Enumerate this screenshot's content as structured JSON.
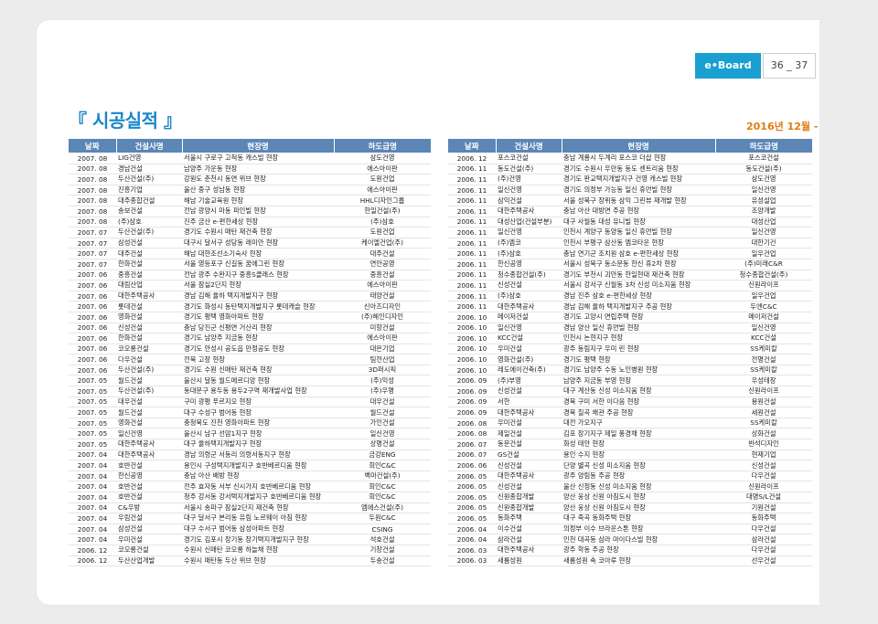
{
  "header": {
    "board_label": "e•Board",
    "page_numbers": "36 _ 37"
  },
  "section": {
    "title": "『 시공실적 』",
    "date": "2016년 12월 -"
  },
  "columns": [
    "날짜",
    "건설사명",
    "현장명",
    "하도급명"
  ],
  "left_rows": [
    [
      "2007. 08",
      "LIG건영",
      "서울시 구로구 고척동 캐스빌 현장",
      "삼도건영"
    ],
    [
      "2007. 08",
      "경남건설",
      "남양주 가운동 현장",
      "에스아이판"
    ],
    [
      "2007. 08",
      "두산건설(주)",
      "강원도 춘천시 동면 위브 현장",
      "도원건업"
    ],
    [
      "2007. 08",
      "진흥기업",
      "울산 중구 성남동 현장",
      "에스아이판"
    ],
    [
      "2007. 08",
      "대주종합건설",
      "해남 기술교육원 현장",
      "HHL디자인그룹"
    ],
    [
      "2007. 08",
      "송보건설",
      "전남 광양시 마동 파인빌 현장",
      "한일건설(주)"
    ],
    [
      "2007. 08",
      "(주)삼호",
      "진주 금산 e-편한세상 현장",
      "(주)삼호"
    ],
    [
      "2007. 07",
      "두산건설(주)",
      "경기도 수원시 매탄 재건축 현장",
      "도원건업"
    ],
    [
      "2007. 07",
      "삼성건설",
      "대구시 달서구 성당동 래미안 현장",
      "케이엘건업(주)"
    ],
    [
      "2007. 07",
      "대주건설",
      "해남 대한조선소기숙사 현장",
      "대주건설"
    ],
    [
      "2007. 07",
      "한화건설",
      "서울 영등포구 신길동 꿈에그린 현장",
      "연안공영"
    ],
    [
      "2007. 06",
      "중흥건설",
      "전남 광주 수완지구 중흥S클래스 현장",
      "중흥건설"
    ],
    [
      "2007. 06",
      "대림산업",
      "서울 잠실2단지 현장",
      "에스아이판"
    ],
    [
      "2007. 06",
      "대한주택공사",
      "경남 김해 율하 택지개발지구 현장",
      "태양건설"
    ],
    [
      "2007. 06",
      "롯데건설",
      "경기도 화성시 동탄택지개발지구 롯데캐슬 현장",
      "신아즈디자인"
    ],
    [
      "2007. 06",
      "영화건설",
      "경기도 평택 영화아파트 현장",
      "(주)해인디자인"
    ],
    [
      "2007. 06",
      "신성건설",
      "충남 당진군 신평면 거산리 현장",
      "미항건설"
    ],
    [
      "2007. 06",
      "한화건설",
      "경기도 남양주 지금동 현장",
      "에스아이판"
    ],
    [
      "2007. 06",
      "코오롱건설",
      "경기도 안성시 공도읍 만정공도 현장",
      "대은기업"
    ],
    [
      "2007. 06",
      "다우건설",
      "전북 고창 현장",
      "팀전산업"
    ],
    [
      "2007. 06",
      "두산건설(주)",
      "경기도 수원 신매탄 재건축 현장",
      "3D퍼시픽"
    ],
    [
      "2007. 05",
      "월드건설",
      "울산시 달동 월드메르디앙 현장",
      "(주)익성"
    ],
    [
      "2007. 05",
      "두산건설(주)",
      "동대문구 용두동 용두2구역 재개발사업 현장",
      "(주)우명"
    ],
    [
      "2007. 05",
      "대우건설",
      "구미 광평 푸르지오 현장",
      "대우건설"
    ],
    [
      "2007. 05",
      "월드건설",
      "대구 수성구 범어동 현장",
      "월드건설"
    ],
    [
      "2007. 05",
      "영화건설",
      "충청북도 진천 영화아파트 현장",
      "가인건설"
    ],
    [
      "2007. 05",
      "일신건영",
      "울산시 남구 선암1지구 현장",
      "일신건영"
    ],
    [
      "2007. 05",
      "대한주택공사",
      "대구 율하택지개발지구 현장",
      "상명건설"
    ],
    [
      "2007. 04",
      "대한주택공사",
      "경남 의령군 서동리 의령서동지구 현장",
      "금강ENG"
    ],
    [
      "2007. 04",
      "호반건설",
      "용인시 구성택지개발지구 호반베르디움 현장",
      "회인C&C"
    ],
    [
      "2007. 04",
      "한신공영",
      "충남 아산 배방 현장",
      "백마건설(주)"
    ],
    [
      "2007. 04",
      "호반건설",
      "전주 효자동 서부 신시가지 호반베르디움 현장",
      "회인C&C"
    ],
    [
      "2007. 04",
      "호반건설",
      "청주 강서동 강서택지개발지구 호반베르디움 현장",
      "회인C&C"
    ],
    [
      "2007. 04",
      "C&우방",
      "서울시 송파구 잠실2단지 재건축 현장",
      "엠에스건설(주)"
    ],
    [
      "2007. 04",
      "우림건설",
      "대구 달서구 본리동 유림 노르웨이 아침 현장",
      "두원C&C"
    ],
    [
      "2007. 04",
      "삼성건설",
      "대구 수서구 범어동 삼성아파트 현장",
      "CSING"
    ],
    [
      "2007. 04",
      "우미건설",
      "경기도 김포시 장기동 장기택지개발지구 현장",
      "석호건설"
    ],
    [
      "2006. 12",
      "코오롱건설",
      "수원시 신매탄 코오롱 하늘채 현장",
      "기창건설"
    ],
    [
      "2006. 12",
      "두산산업개발",
      "수원시 매탄동 두산 위브 현장",
      "두송건설"
    ]
  ],
  "right_rows": [
    [
      "2006. 12",
      "포스코건설",
      "충남 계룡시 두계리 포스코 더샵 현장",
      "포스코건설"
    ],
    [
      "2006. 11",
      "동도건설(주)",
      "경기도 수원시 우만동 동도 센트리움 현장",
      "동도건설(주)"
    ],
    [
      "2006. 11",
      "(주)건영",
      "경기도 판교택지개발지구 건영 캐스빌 현장",
      "삼도건영"
    ],
    [
      "2006. 11",
      "일신건영",
      "경기도 의정부 가능동 일신 휴먼빌 현장",
      "일신건영"
    ],
    [
      "2006. 11",
      "삼익건설",
      "서울 성북구 장위동 삼익 그린뷰 재개발 현장",
      "유성설업"
    ],
    [
      "2006. 11",
      "대한주택공사",
      "충남 아산 대방면 주공 현장",
      "조양개발"
    ],
    [
      "2006. 11",
      "대성산업(건설부분)",
      "대구 사월동 대성 유니빌 현장",
      "대성산업"
    ],
    [
      "2006. 11",
      "일신건영",
      "인천시 계양구 동양동 일신 휴먼빌 현장",
      "일신건영"
    ],
    [
      "2006. 11",
      "(주)엠코",
      "인천시 부평구 삼산동 엠코타운 현장",
      "대한기건"
    ],
    [
      "2006. 11",
      "(주)삼호",
      "충남 연기군 조치원 삼호 e-편한세상 현장",
      "일우건업"
    ],
    [
      "2006. 11",
      "한신공영",
      "서울시 성북구 동소문동 한신 휴2차 현장",
      "(주)미래C&R"
    ],
    [
      "2006. 11",
      "청수종합건설(주)",
      "경기도 부천시 괴안동 한일현대 재건축 현장",
      "청수종합건설(주)"
    ],
    [
      "2006. 11",
      "신성건설",
      "서울시 강서구 신월동 3차 신성 미소지움 현장",
      "신원라이프"
    ],
    [
      "2006. 11",
      "(주)삼호",
      "경남 진주 삼호 e-편한세상 현장",
      "일우건업"
    ],
    [
      "2006. 11",
      "대한주택공사",
      "경남 김해 율하 택지개발지구 주공 현장",
      "두엔C&C"
    ],
    [
      "2006. 10",
      "메이저건설",
      "경기도 고양시 면립주택 현장",
      "메이저건설"
    ],
    [
      "2006. 10",
      "일신건영",
      "경남 양산 일신 휴먼빌 현장",
      "일신건영"
    ],
    [
      "2006. 10",
      "KCC건설",
      "인천시 논현지구 현장",
      "KCC건설"
    ],
    [
      "2006. 10",
      "우미건설",
      "광주 동림지구 우미 린 현장",
      "SS케미칼"
    ],
    [
      "2006. 10",
      "영화건설(주)",
      "경기도 평택 현장",
      "전명건설"
    ],
    [
      "2006. 10",
      "레도에이건축(주)",
      "경기도 남양주 수동 노인병원 현장",
      "SS케미칼"
    ],
    [
      "2006. 09",
      "(주)부영",
      "남양주 지금동 부영 현장",
      "우성테창"
    ],
    [
      "2006. 09",
      "신성건설",
      "대구 계산동 신성 미소지움 현장",
      "신원라이프"
    ],
    [
      "2006. 09",
      "서한",
      "경북 구미 서한 이다음 현장",
      "용원건설"
    ],
    [
      "2006. 09",
      "대한주택공사",
      "경북 칠곡 왜관 주공 현장",
      "세원건설"
    ],
    [
      "2006. 08",
      "우미건설",
      "대전 가오지구",
      "SS케미칼"
    ],
    [
      "2006. 08",
      "제일건설",
      "김포 장기지구 제일 풍경채 현장",
      "상화건설"
    ],
    [
      "2006. 07",
      "동문건설",
      "화성 태안 현장",
      "반석디자인"
    ],
    [
      "2006. 07",
      "GS건설",
      "용인 수지 현장",
      "현재기업"
    ],
    [
      "2006. 06",
      "신성건설",
      "단양 별곡 신성 미소지움 현장",
      "신성건설"
    ],
    [
      "2006. 05",
      "대한주택공사",
      "광주 양림동 주공 현장",
      "다우건설"
    ],
    [
      "2006. 05",
      "신성건설",
      "울산 신정동 신성 미소지움 현장",
      "신원라이프"
    ],
    [
      "2006. 05",
      "신원종합개발",
      "양산 웅상 신원 아침도시 현장",
      "대명S/L건설"
    ],
    [
      "2006. 05",
      "신원종합개발",
      "양산 웅상 신원 아침도시 현장",
      "기원건설"
    ],
    [
      "2006. 05",
      "동화주택",
      "대구 죽곡 동화주택 현장",
      "동화주택"
    ],
    [
      "2006. 04",
      "이수건설",
      "의정부 이수 브라운스톤 현장",
      "다우건설"
    ],
    [
      "2006. 04",
      "삼라건설",
      "인천 대곡동 삼라 마이다스빌 현장",
      "삼라건설"
    ],
    [
      "2006. 03",
      "대한주택공사",
      "광주 학동 주공 현장",
      "다우건설"
    ],
    [
      "2006. 03",
      "새롬성원",
      "새롬성원 속 코아루 현장",
      "선우건설"
    ]
  ]
}
